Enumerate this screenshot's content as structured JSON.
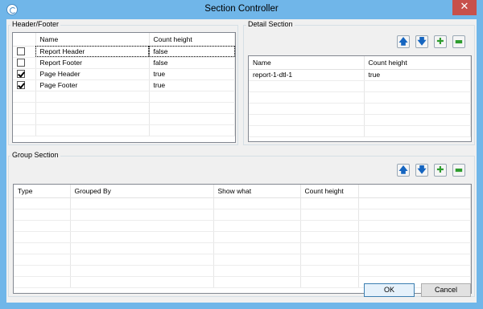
{
  "window": {
    "title": "Section Controller",
    "close_glyph": "✕",
    "icon": "app-icon"
  },
  "header_footer": {
    "label": "Header/Footer",
    "columns": [
      "",
      "Name",
      "Count height"
    ],
    "rows": [
      {
        "checked": false,
        "name": "Report Header",
        "count_height": "false"
      },
      {
        "checked": false,
        "name": "Report Footer",
        "count_height": "false"
      },
      {
        "checked": true,
        "name": "Page Header",
        "count_height": "true"
      },
      {
        "checked": true,
        "name": "Page Footer",
        "count_height": "true"
      }
    ]
  },
  "detail_section": {
    "label": "Detail Section",
    "columns": [
      "Name",
      "Count height"
    ],
    "rows": [
      {
        "name": "report-1-dtl-1",
        "count_height": "true"
      }
    ],
    "toolbar": {
      "up": "🡅",
      "down": "🡇",
      "add": "✚",
      "remove": "▬"
    }
  },
  "group_section": {
    "label": "Group Section",
    "columns": [
      "Type",
      "Grouped By",
      "Show what",
      "Count height",
      ""
    ],
    "rows": [],
    "toolbar": {
      "up": "🡅",
      "down": "🡇",
      "add": "✚",
      "remove": "▬"
    }
  },
  "buttons": {
    "ok": "OK",
    "cancel": "Cancel"
  }
}
